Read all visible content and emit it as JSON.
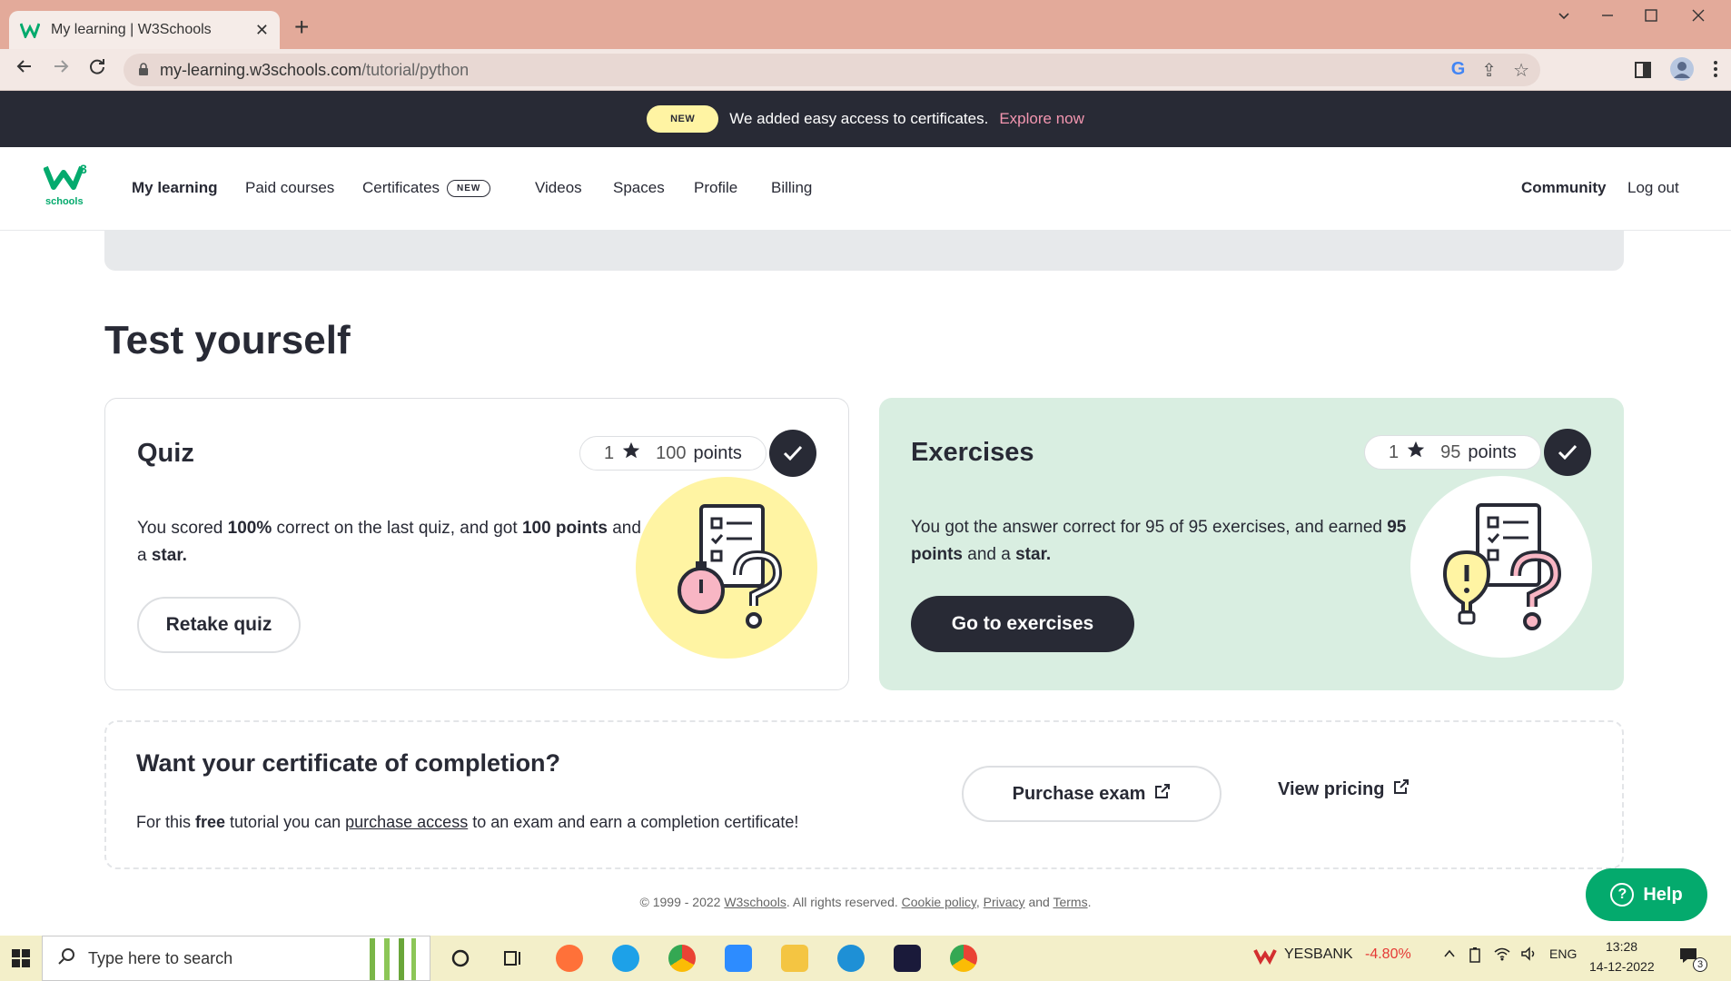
{
  "browser": {
    "tab_title": "My learning | W3Schools",
    "tab_close": "✕",
    "new_tab": "+",
    "url_domain": "my-learning.w3schools.com",
    "url_path": "/tutorial/python"
  },
  "announcement": {
    "badge": "NEW",
    "text": "We added easy access to certificates.",
    "link": "Explore now"
  },
  "nav": {
    "logo_mark": "w",
    "logo_sup": "3",
    "logo_text": "schools",
    "items": [
      "My learning",
      "Paid courses",
      "Certificates",
      "Videos",
      "Spaces",
      "Profile",
      "Billing"
    ],
    "certificates_badge": "NEW",
    "community": "Community",
    "logout": "Log out"
  },
  "section_title": "Test yourself",
  "quiz": {
    "title": "Quiz",
    "stars": "1",
    "points_num": "100",
    "points_label": "points",
    "desc_1": "You scored ",
    "desc_b1": "100%",
    "desc_2": " correct on the last quiz, and got ",
    "desc_b2": "100 points",
    "desc_3": " and a ",
    "desc_b3": "star.",
    "button": "Retake quiz"
  },
  "exercises": {
    "title": "Exercises",
    "stars": "1",
    "points_num": "95",
    "points_label": "points",
    "desc_1": "You got the answer correct for 95 of 95 exercises, and earned ",
    "desc_b1": "95 points",
    "desc_2": " and a ",
    "desc_b2": "star.",
    "button": "Go to exercises"
  },
  "certificate": {
    "title": "Want your certificate of completion?",
    "desc_1": "For this ",
    "desc_b": "free",
    "desc_2": " tutorial you can ",
    "desc_link": "purchase access",
    "desc_3": " to an exam and earn a completion certificate!",
    "purchase_button": "Purchase exam",
    "pricing_button": "View pricing"
  },
  "footer": {
    "copy": "© 1999 - 2022 ",
    "brand": "W3schools",
    "rights": ". All rights reserved. ",
    "cookie": "Cookie policy",
    "comma": ", ",
    "privacy": "Privacy",
    "and": " and ",
    "terms": "Terms",
    "dot": "."
  },
  "help_label": "Help",
  "taskbar": {
    "search_placeholder": "Type here to search",
    "stock_name": "YESBANK",
    "stock_change": "-4.80%",
    "lang": "ENG",
    "time": "13:28",
    "date": "14-12-2022",
    "notif_count": "3"
  },
  "colors": {
    "brand_green": "#04aa6d",
    "dark": "#282a35",
    "exercise_bg": "#d9eee1",
    "quiz_illus": "#fff4a3",
    "stock_red": "#e53935"
  }
}
